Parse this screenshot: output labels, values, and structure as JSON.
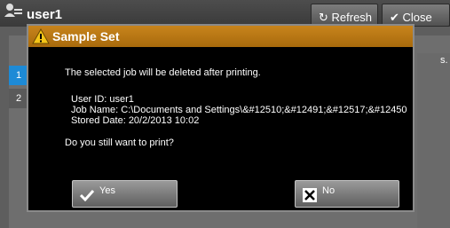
{
  "background": {
    "user_title": "user1",
    "refresh_label": "Refresh",
    "close_label": "Close",
    "rows": [
      "1",
      "2"
    ],
    "side_fragment": "s."
  },
  "dialog": {
    "title": "Sample Set",
    "message": "The selected job will be deleted after printing.",
    "user_id": "User ID: user1",
    "job_name": "Job Name: C:\\Documents and Settings\\&#12510;&#12491;&#12517;&#12450",
    "stored_date": "Stored Date: 20/2/2013 10:02",
    "question": "Do you still want to print?",
    "yes_label": "Yes",
    "no_label": "No"
  },
  "colors": {
    "title_bar": "#b9771a",
    "dialog_bg": "#000000",
    "selected_row": "#1d8ad6"
  },
  "icons": {
    "title": "warning-icon",
    "yes": "checkmark-icon",
    "no": "x-box-icon"
  }
}
